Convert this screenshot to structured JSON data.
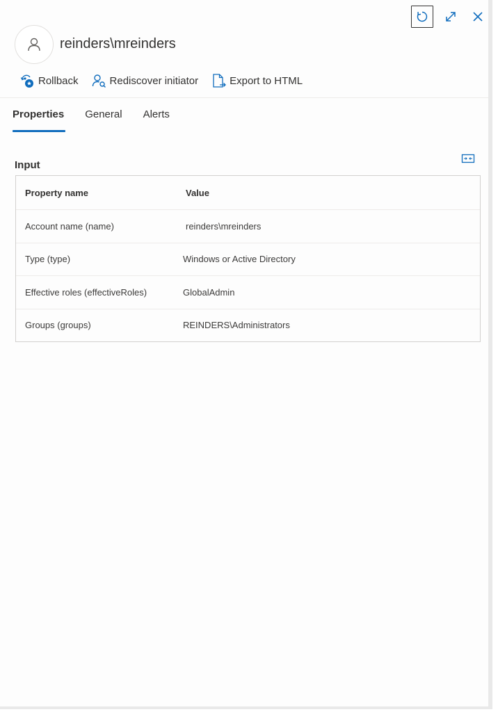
{
  "window": {
    "refresh_icon": "refresh-icon",
    "expand_icon": "expand-icon",
    "close_icon": "close-icon"
  },
  "entity": {
    "title": "reinders\\mreinders",
    "avatar_icon": "person-icon"
  },
  "toolbar": {
    "items": [
      {
        "label": "Rollback",
        "icon": "rollback-icon"
      },
      {
        "label": "Rediscover initiator",
        "icon": "rediscover-icon"
      },
      {
        "label": "Export to HTML",
        "icon": "export-icon"
      }
    ]
  },
  "tabs": [
    {
      "label": "Properties",
      "active": true
    },
    {
      "label": "General",
      "active": false
    },
    {
      "label": "Alerts",
      "active": false
    }
  ],
  "input_section": {
    "title": "Input",
    "collapse_icon": "collapse-icon",
    "columns": [
      "Property name",
      "Value"
    ],
    "rows": [
      {
        "name": "Account name (name)",
        "value": "reinders\\mreinders"
      },
      {
        "name": "Type (type)",
        "value": "Windows or Active Directory"
      },
      {
        "name": "Effective roles (effectiveRoles)",
        "value": "GlobalAdmin"
      },
      {
        "name": "Groups (groups)",
        "value": "REINDERS\\Administrators"
      }
    ]
  },
  "colors": {
    "accent": "#0f6cbd",
    "text": "#323130",
    "border": "#d2d0ce"
  }
}
